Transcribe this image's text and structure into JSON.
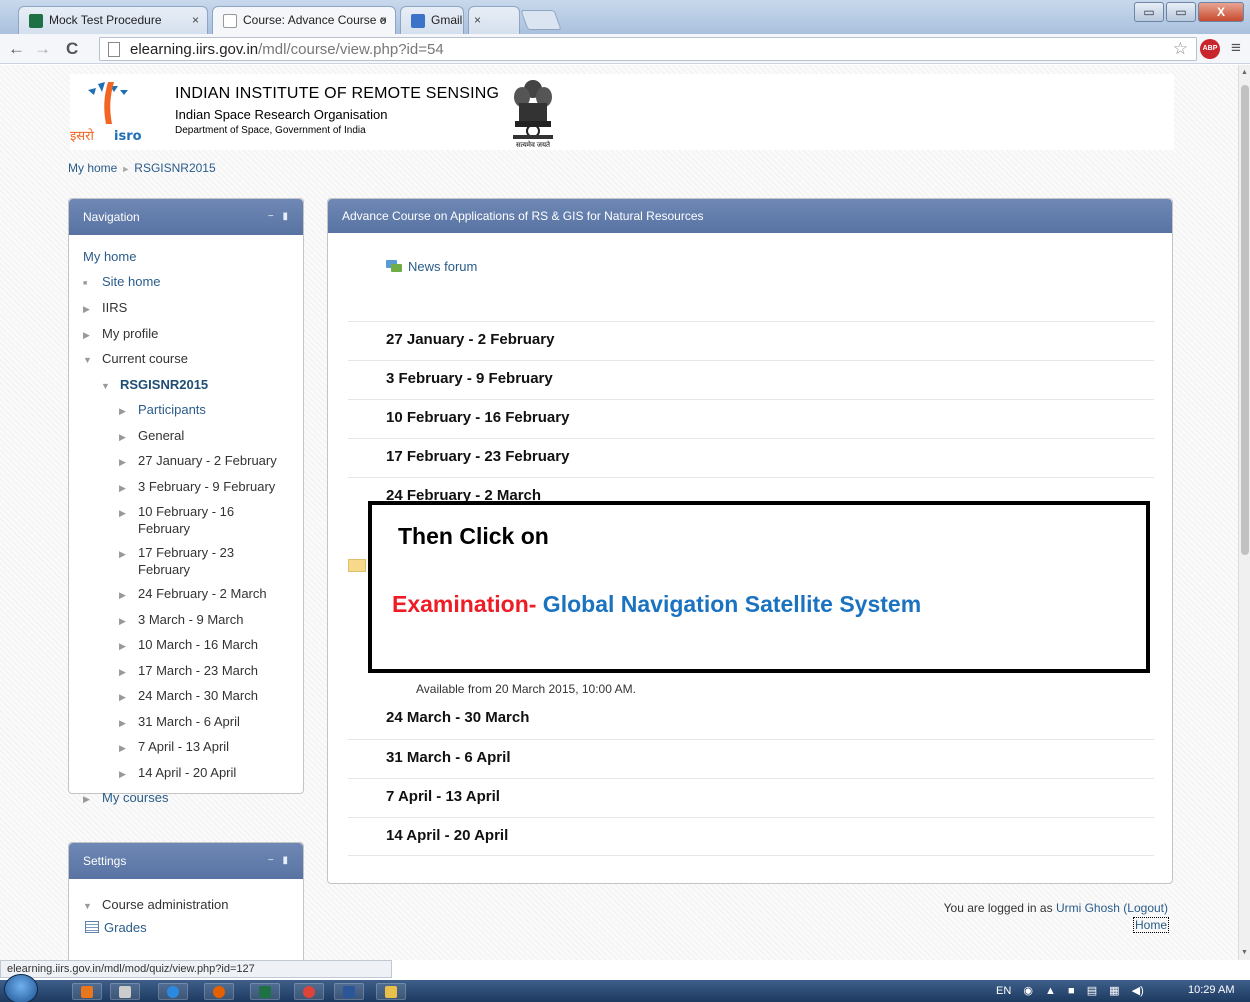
{
  "browser": {
    "tabs": [
      {
        "title": "Mock Test Procedure",
        "icon": "excel-doc-icon",
        "close": "×"
      },
      {
        "title": "Course: Advance Course o",
        "icon": "page-icon",
        "close": "×"
      },
      {
        "title": "Gmail",
        "icon": "google-plus-icon",
        "close": "×"
      }
    ],
    "back": "←",
    "forward": "→",
    "reload": "C",
    "url_host": "elearning.iirs.gov.in",
    "url_path": "/mdl/course/view.php?id=54",
    "star": "☆",
    "abp_badge": "ABP",
    "menu": "≡",
    "window_buttons": [
      "▭",
      "▭",
      "X"
    ]
  },
  "header": {
    "institute": "INDIAN INSTITUTE OF REMOTE SENSING",
    "organisation": "Indian Space Research Organisation",
    "department": "Department of Space, Government of India",
    "isro_logo_text_left": "इसरो",
    "isro_logo_text_right": "isro",
    "emblem_motto": "सत्यमेव जयते"
  },
  "breadcrumb": {
    "home": "My home",
    "sep": "►",
    "course": "RSGISNR2015"
  },
  "navigation": {
    "title": "Navigation",
    "items": [
      {
        "label": "My home"
      },
      {
        "label": "Site home"
      },
      {
        "label": "IIRS"
      },
      {
        "label": "My profile"
      },
      {
        "label": "Current course"
      },
      {
        "label": "RSGISNR2015"
      },
      {
        "label": "Participants"
      },
      {
        "label": "General"
      },
      {
        "label": "27 January - 2 February"
      },
      {
        "label": "3 February - 9 February"
      },
      {
        "label": "10 February - 16 February"
      },
      {
        "label": "17 February - 23 February"
      },
      {
        "label": "24 February - 2 March"
      },
      {
        "label": "3 March - 9 March"
      },
      {
        "label": "10 March - 16 March"
      },
      {
        "label": "17 March - 23 March"
      },
      {
        "label": "24 March - 30 March"
      },
      {
        "label": "31 March - 6 April"
      },
      {
        "label": "7 April - 13 April"
      },
      {
        "label": "14 April - 20 April"
      },
      {
        "label": "My courses"
      }
    ]
  },
  "settings": {
    "title": "Settings",
    "admin": "Course administration",
    "grades": "Grades"
  },
  "course": {
    "title": "Advance Course on Applications of RS & GIS for Natural Resources",
    "news_forum": "News forum",
    "weeks": [
      "27 January - 2 February",
      "3 February - 9 February",
      "10 February - 16 February",
      "17 February - 23 February",
      "24 February - 2 March",
      "24 March - 30 March",
      "31 March - 6 April",
      "7 April - 13 April",
      "14 April - 20 April"
    ],
    "availability": "Available from 20 March 2015, 10:00 AM."
  },
  "annotation": {
    "line1": "Then Click on",
    "exam_red": "Examination-",
    "exam_blue": " Global Navigation Satellite System"
  },
  "footer": {
    "logged_in_prefix": "You are logged in as ",
    "user": "Urmi Ghosh",
    "logout": "(Logout)",
    "home": "Home"
  },
  "status_url": "elearning.iirs.gov.in/mdl/mod/quiz/view.php?id=127",
  "taskbar": {
    "lang": "EN",
    "clock": "10:29 AM",
    "apps": [
      "outlook-icon",
      "files-icon",
      "ie-icon",
      "firefox-icon",
      "excel-icon",
      "chrome-icon",
      "word-icon",
      "explorer-icon"
    ]
  },
  "colors": {
    "block_header": "#5f7aab",
    "link": "#2a5c8a",
    "annotation_red": "#ee1c25",
    "annotation_blue": "#1b72c0"
  }
}
